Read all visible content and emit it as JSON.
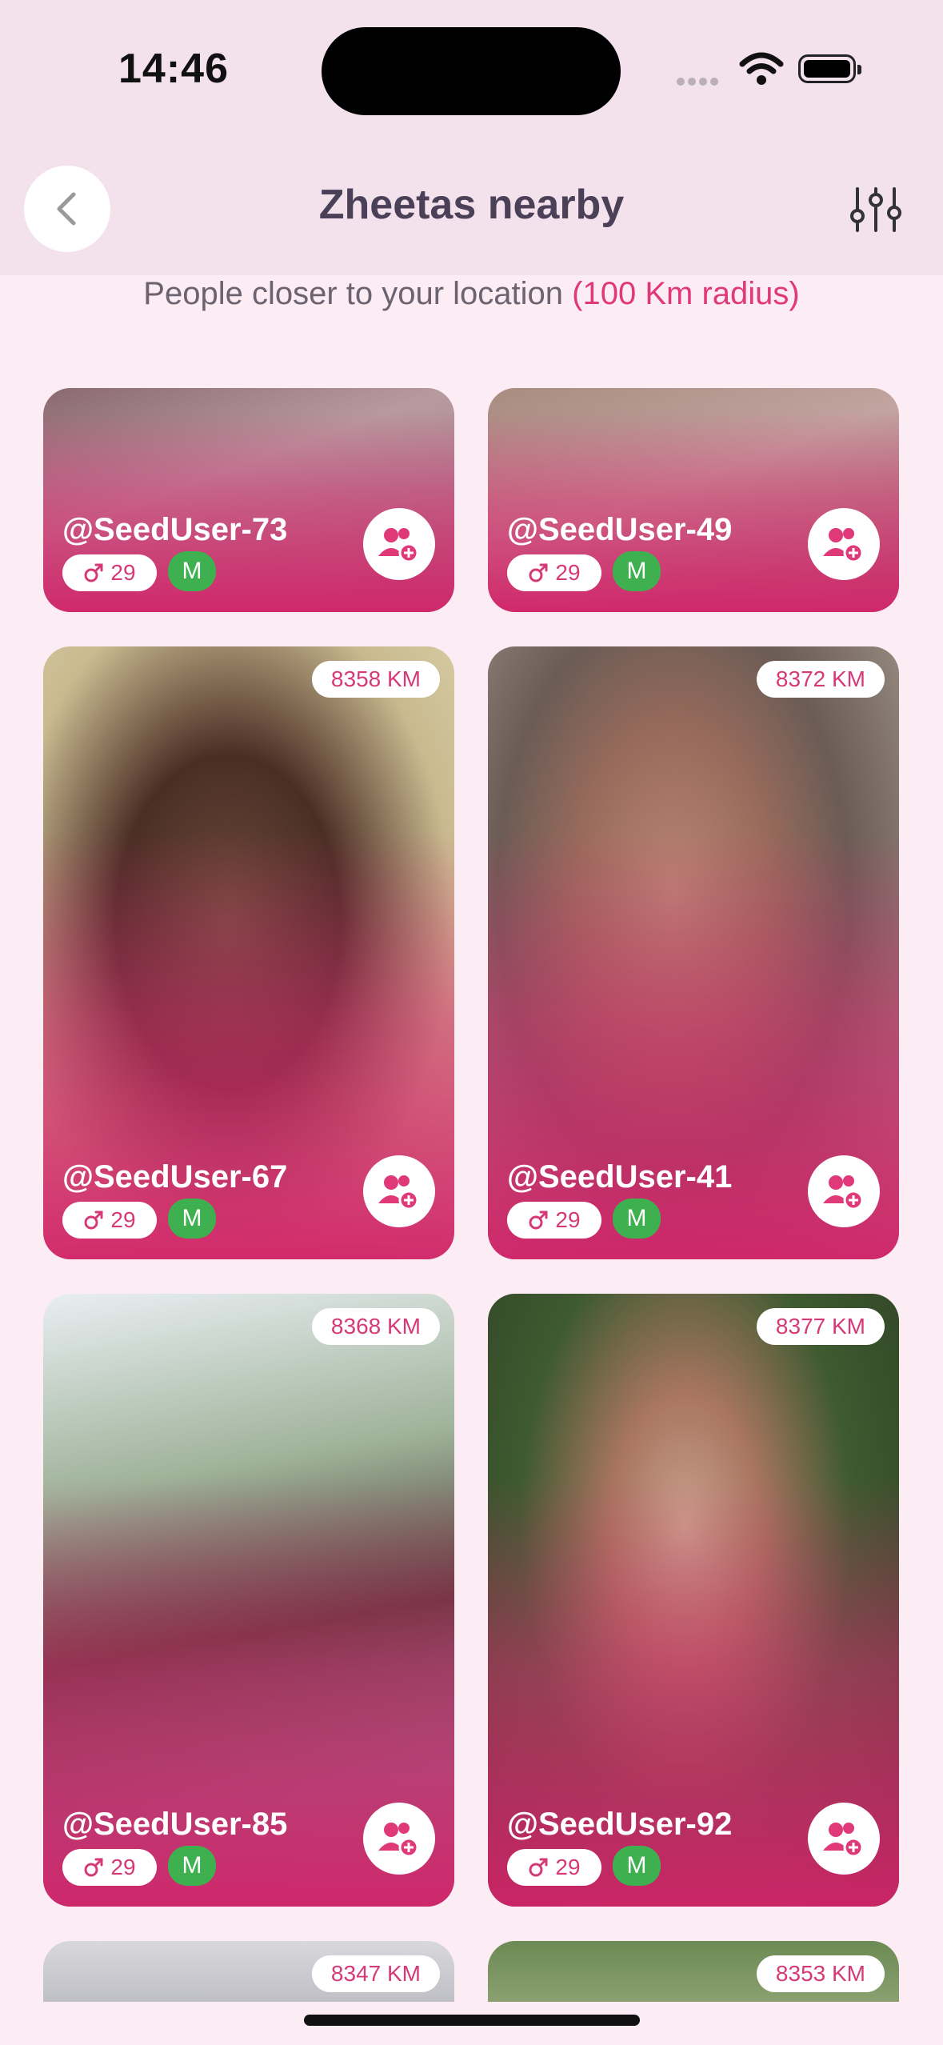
{
  "status_bar": {
    "time": "14:46"
  },
  "header": {
    "title": "Zheetas nearby"
  },
  "subtitle": {
    "text": "People closer to your location",
    "accent": "(100 Km radius)"
  },
  "colors": {
    "accent": "#e0397a",
    "badge_green": "#3fb04f",
    "background": "#fcecf4"
  },
  "cards": [
    {
      "username": "@SeedUser-73",
      "age": "29",
      "gender_badge": "M",
      "distance": ""
    },
    {
      "username": "@SeedUser-49",
      "age": "29",
      "gender_badge": "M",
      "distance": ""
    },
    {
      "username": "@SeedUser-67",
      "age": "29",
      "gender_badge": "M",
      "distance": "8358 KM"
    },
    {
      "username": "@SeedUser-41",
      "age": "29",
      "gender_badge": "M",
      "distance": "8372 KM"
    },
    {
      "username": "@SeedUser-85",
      "age": "29",
      "gender_badge": "M",
      "distance": "8368 KM"
    },
    {
      "username": "@SeedUser-92",
      "age": "29",
      "gender_badge": "M",
      "distance": "8377 KM"
    },
    {
      "distance": "8347 KM"
    },
    {
      "distance": "8353 KM"
    }
  ],
  "icons": {
    "back": "chevron-left-icon",
    "filter": "sliders-icon",
    "add": "add-friend-icon",
    "gender": "male-icon"
  }
}
